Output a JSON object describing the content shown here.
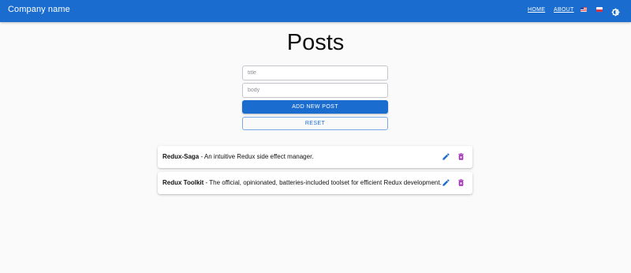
{
  "appbar": {
    "brand": "Company name",
    "nav": [
      {
        "label": "HOME"
      },
      {
        "label": "ABOUT"
      }
    ],
    "languages": [
      {
        "icon": "us-flag-icon"
      },
      {
        "icon": "pl-flag-icon"
      }
    ],
    "theme_toggle_icon": "brightness-icon"
  },
  "page": {
    "title": "Posts"
  },
  "form": {
    "title_placeholder": "title",
    "body_placeholder": "body",
    "submit_label": "ADD NEW POST",
    "reset_label": "RESET"
  },
  "posts": [
    {
      "title": "Redux-Saga",
      "separator": " - ",
      "body": "An intuitive Redux side effect manager."
    },
    {
      "title": "Redux Toolkit",
      "separator": " - ",
      "body": "The official, opinionated, batteries-included toolset for efficient Redux development."
    }
  ],
  "colors": {
    "primary": "#1a6ccf",
    "edit": "#1a6ccf",
    "delete": "#9b27b0",
    "background": "#fafafb"
  }
}
